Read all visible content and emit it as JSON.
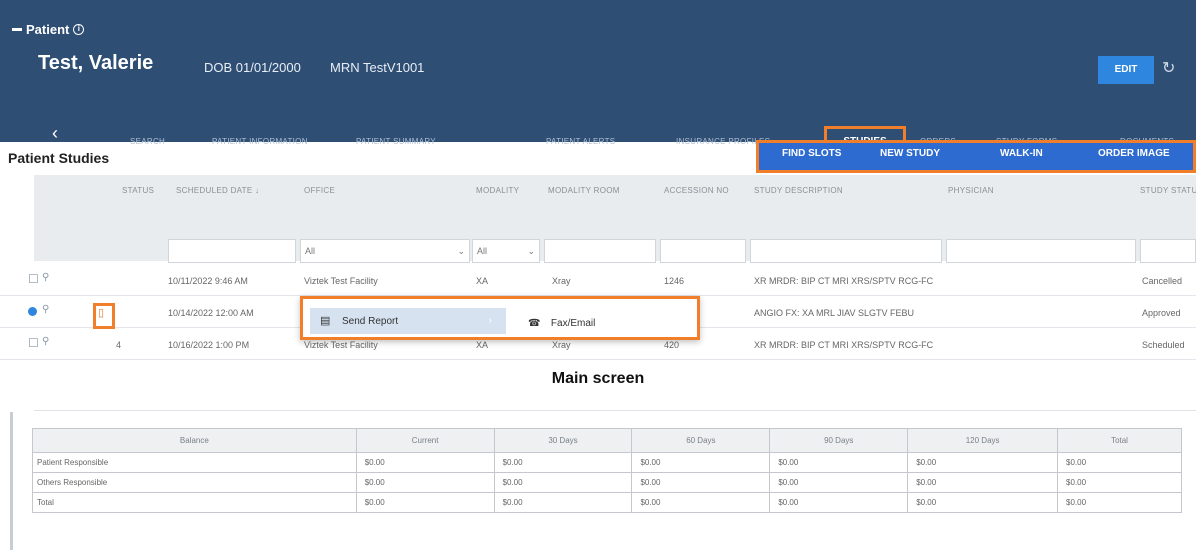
{
  "header": {
    "patient_tag": "Patient",
    "patient_name": "Test, Valerie",
    "dob": "DOB 01/01/2000",
    "mrn": "MRN TestV1001",
    "edit_label": "EDIT"
  },
  "tabs": {
    "search": "SEARCH",
    "patient_information": "PATIENT INFORMATION",
    "patient_summary": "PATIENT SUMMARY",
    "patient_alerts": "PATIENT ALERTS",
    "insurance_profiles": "INSURANCE PROFILES",
    "studies": "STUDIES",
    "orders": "ORDERS",
    "study_forms": "STUDY FORMS",
    "documents": "DOCUMENTS"
  },
  "section": {
    "title": "Patient Studies",
    "actions": [
      "FIND SLOTS",
      "NEW STUDY",
      "WALK-IN",
      "ORDER IMAGE"
    ]
  },
  "grid": {
    "headers": [
      "STATUS",
      "SCHEDULED DATE ↓",
      "OFFICE",
      "MODALITY",
      "MODALITY ROOM",
      "ACCESSION NO",
      "STUDY DESCRIPTION",
      "PHYSICIAN",
      "STUDY STATUS"
    ],
    "filters": {
      "office": "All",
      "modality": "All"
    },
    "rows": [
      {
        "date": "10/11/2022 9:46 AM",
        "office": "Viztek Test Facility",
        "modality": "XA",
        "room": "Xray",
        "accession": "1246",
        "description": "XR MRDR: BIP CT MRI XRS/SPTV RCG-FC",
        "status": "Cancelled"
      },
      {
        "date": "10/14/2022 12:00 AM",
        "office": "",
        "modality": "",
        "room": "",
        "accession": "",
        "description": "ANGIO FX: XA MRL JIAV SLGTV FEBU",
        "status": "Approved"
      },
      {
        "date": "10/16/2022 1:00 PM",
        "office": "Viztek Test Facility",
        "modality": "XA",
        "room": "Xray",
        "accession": "420",
        "description": "XR MRDR: BIP CT MRI XRS/SPTV RCG-FC",
        "status": "Scheduled"
      }
    ],
    "row3_number": "4"
  },
  "context_menu": {
    "send_report": "Send Report",
    "fax_email": "Fax/Email"
  },
  "caption": "Main screen",
  "balance_table": {
    "headers": [
      "Balance",
      "Current",
      "30 Days",
      "60 Days",
      "90 Days",
      "120 Days",
      "Total"
    ],
    "rows": [
      {
        "label": "Patient Responsible",
        "values": [
          "$0.00",
          "$0.00",
          "$0.00",
          "$0.00",
          "$0.00",
          "$0.00"
        ]
      },
      {
        "label": "Others Responsible",
        "values": [
          "$0.00",
          "$0.00",
          "$0.00",
          "$0.00",
          "$0.00",
          "$0.00"
        ]
      },
      {
        "label": "Total",
        "values": [
          "$0.00",
          "$0.00",
          "$0.00",
          "$0.00",
          "$0.00",
          "$0.00"
        ]
      }
    ]
  },
  "colors": {
    "header_bg": "#2f4e74",
    "accent_orange": "#f07e2a",
    "action_blue": "#2e6bd0"
  }
}
